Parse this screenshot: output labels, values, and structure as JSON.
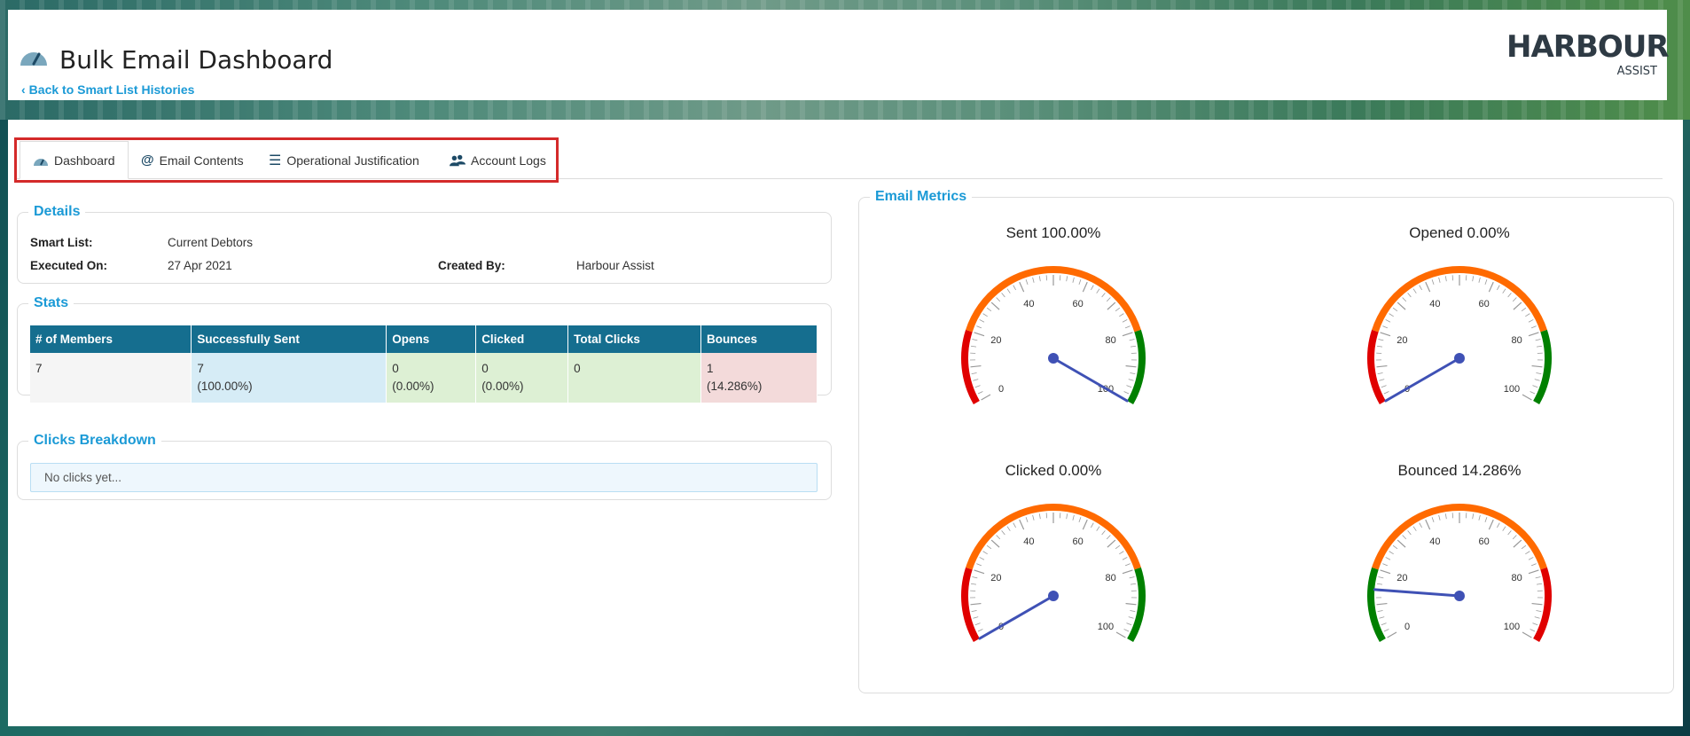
{
  "header": {
    "title": "Bulk Email Dashboard",
    "back_link": "Back to Smart List Histories",
    "logo_main": "HARBOUR",
    "logo_sub": "ASSIST"
  },
  "tabs": [
    {
      "label": "Dashboard",
      "icon": "dashboard-gauge-icon"
    },
    {
      "label": "Email Contents",
      "icon": "at-sign-icon"
    },
    {
      "label": "Operational Justification",
      "icon": "list-icon"
    },
    {
      "label": "Account Logs",
      "icon": "users-icon"
    }
  ],
  "details": {
    "legend": "Details",
    "smart_list_label": "Smart List:",
    "smart_list_value": "Current Debtors",
    "executed_label": "Executed On:",
    "executed_value": "27 Apr 2021",
    "created_label": "Created By:",
    "created_value": "Harbour Assist"
  },
  "stats": {
    "legend": "Stats",
    "headers": [
      "# of Members",
      "Successfully Sent",
      "Opens",
      "Clicked",
      "Total Clicks",
      "Bounces"
    ],
    "row": {
      "members": "7",
      "sent": "7",
      "sent_pct": "(100.00%)",
      "opens": "0",
      "opens_pct": "(0.00%)",
      "clicked": "0",
      "clicked_pct": "(0.00%)",
      "total_clicks": "0",
      "bounces": "1",
      "bounces_pct": "(14.286%)"
    }
  },
  "clicks": {
    "legend": "Clicks Breakdown",
    "empty": "No clicks yet..."
  },
  "metrics": {
    "legend": "Email Metrics",
    "gauges": [
      {
        "title": "Sent 100.00%",
        "value": 100,
        "zones": [
          "#e00000",
          "#ff6a00",
          "#008000"
        ]
      },
      {
        "title": "Opened 0.00%",
        "value": 0,
        "zones": [
          "#e00000",
          "#ff6a00",
          "#008000"
        ]
      },
      {
        "title": "Clicked 0.00%",
        "value": 0,
        "zones": [
          "#e00000",
          "#ff6a00",
          "#008000"
        ]
      },
      {
        "title": "Bounced 14.286%",
        "value": 14.286,
        "zones": [
          "#008000",
          "#ff6a00",
          "#e00000"
        ]
      }
    ],
    "tick_labels": [
      "0",
      "20",
      "40",
      "60",
      "80",
      "100"
    ]
  },
  "colors": {
    "accent": "#1b9ad6",
    "table_header": "#156e8f",
    "needle": "#3f51b5",
    "highlight_border": "#d42a2a"
  }
}
